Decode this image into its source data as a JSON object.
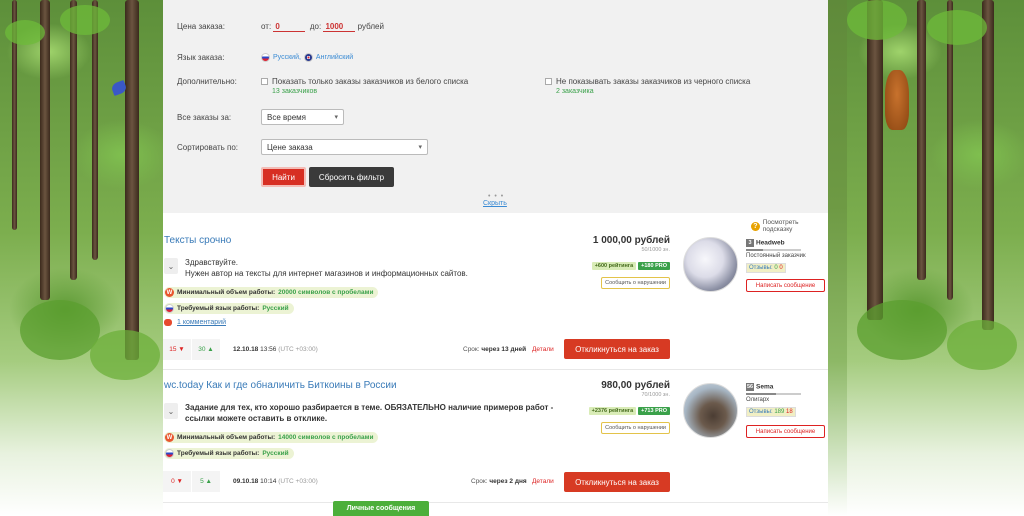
{
  "filter": {
    "price_label": "Цена заказа:",
    "price_from_label": "от:",
    "price_from": "0",
    "price_to_label": "до:",
    "price_to": "1000",
    "price_currency": "рублей",
    "language_label": "Язык заказа:",
    "lang_ru": "Русский,",
    "lang_en": "Английский",
    "additional_label": "Дополнительно:",
    "whitelist_label": "Показать только заказы заказчиков из белого списка",
    "whitelist_count": "13 заказчиков",
    "blacklist_label": "Не показывать заказы заказчиков из черного списка",
    "blacklist_count": "2 заказчика",
    "period_label": "Все заказы за:",
    "period_value": "Все время",
    "sort_label": "Сортировать по:",
    "sort_value": "Цене заказа",
    "find_button": "Найти",
    "reset_button": "Сбросить фильтр",
    "dots": "• • •",
    "hide_link": "Скрыть"
  },
  "hint": {
    "icon": "question-icon",
    "label": "Посмотреть подсказку"
  },
  "orders": [
    {
      "title": "Тексты срочно",
      "price": "1 000,00 рублей",
      "views": "50/1000 зн.",
      "desc_line1": "Здравствуйте.",
      "desc_line2": "Нужен автор на тексты для интернет магазинов и информационных сайтов.",
      "min_volume_label": "Минимальный объем работы:",
      "min_volume_value": "20000 символов с пробелами",
      "lang_req_label": "Требуемый язык работы:",
      "lang_req_value": "Русский",
      "comments": "1 комментарий",
      "rating_badge": "+600 рейтинга",
      "pro_badge": "+180 PRO",
      "report": "Сообщить о нарушении",
      "votes_neg": "15",
      "votes_pos": "30",
      "date": "12.10.18",
      "time": "13:56",
      "tz": "(UTC +03:00)",
      "deadline_label": "Срок:",
      "deadline_value": "через 13 дней",
      "details": "Детали",
      "respond": "Откликнуться на заказ",
      "user_level": "3",
      "user_name": "Headweb",
      "user_role": "Постоянный заказчик",
      "reviews_label": "Отзывы:",
      "reviews_pos": "0",
      "reviews_neg": "0",
      "message_button": "Написать сообщение",
      "avatar": "tiger"
    },
    {
      "title": "wc.today Как и где обналичить Биткоины в России",
      "price": "980,00 рублей",
      "views": "70/1000 зн.",
      "desc_line1": "Задание для тех, кто хорошо разбирается в теме. ОБЯЗАТЕЛЬНО наличие примеров работ -",
      "desc_line2": "ссылки можете оставить в отклике.",
      "min_volume_label": "Минимальный объем работы:",
      "min_volume_value": "14000 символов с пробелами",
      "lang_req_label": "Требуемый язык работы:",
      "lang_req_value": "Русский",
      "rating_badge": "+2376 рейтинга",
      "pro_badge": "+713 PRO",
      "report": "Сообщить о нарушении",
      "votes_neg": "0",
      "votes_pos": "5",
      "date": "09.10.18",
      "time": "10:14",
      "tz": "(UTC +03:00)",
      "deadline_label": "Срок:",
      "deadline_value": "через 2 дня",
      "details": "Детали",
      "respond": "Откликнуться на заказ",
      "user_level": "56",
      "user_name": "Sema",
      "user_role": "Олигарх",
      "reviews_label": "Отзывы:",
      "reviews_pos": "189",
      "reviews_neg": "18",
      "message_button": "Написать сообщение",
      "avatar": "wolf"
    }
  ],
  "personal_messages": "Личные сообщения",
  "colors": {
    "accent_red": "#d73a23",
    "link_blue": "#3a7bb8",
    "green": "#3aa14a"
  }
}
